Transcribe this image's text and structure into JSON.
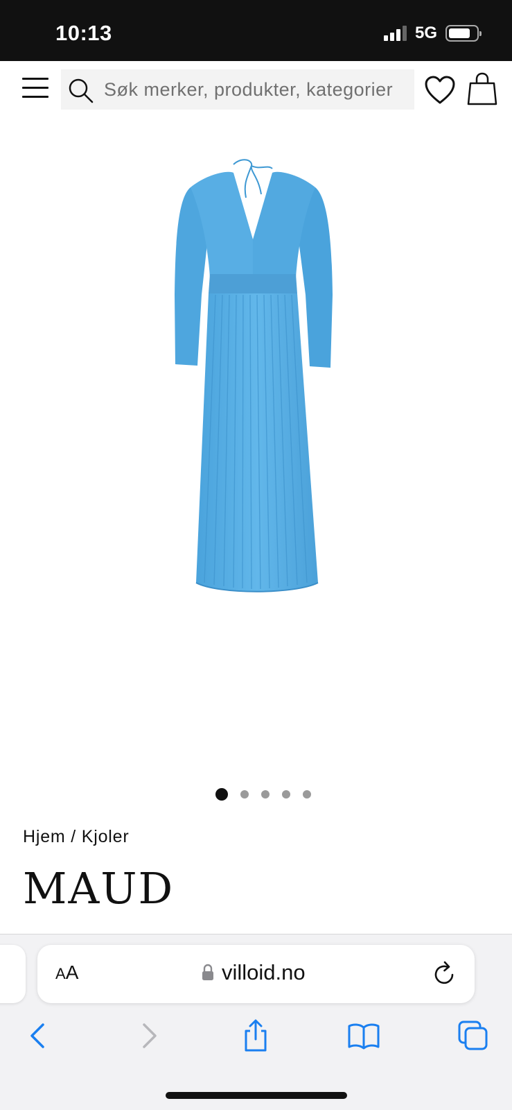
{
  "status_bar": {
    "time": "10:13",
    "network": "5G",
    "icons": [
      "signal-icon",
      "battery-icon"
    ]
  },
  "header": {
    "menu_icon": "hamburger-menu-icon",
    "search": {
      "placeholder": "Søk merker, produkter, kategorier",
      "value": "",
      "icon": "search-icon"
    },
    "wishlist_icon": "heart-icon",
    "cart_icon": "shopping-bag-icon"
  },
  "product": {
    "image_description_icon": "product-image",
    "image_color": "#55ACE3",
    "carousel": {
      "total": 5,
      "active_index": 0
    },
    "breadcrumb": "Hjem / Kjoler",
    "brand": "MAUD"
  },
  "browser": {
    "text_size_label_small": "A",
    "text_size_label_large": "A",
    "url": "villoid.no",
    "accent_color": "#1a7ff0",
    "toolbar_icons": [
      "back-icon",
      "forward-icon",
      "share-icon",
      "bookmarks-icon",
      "tabs-icon"
    ]
  }
}
